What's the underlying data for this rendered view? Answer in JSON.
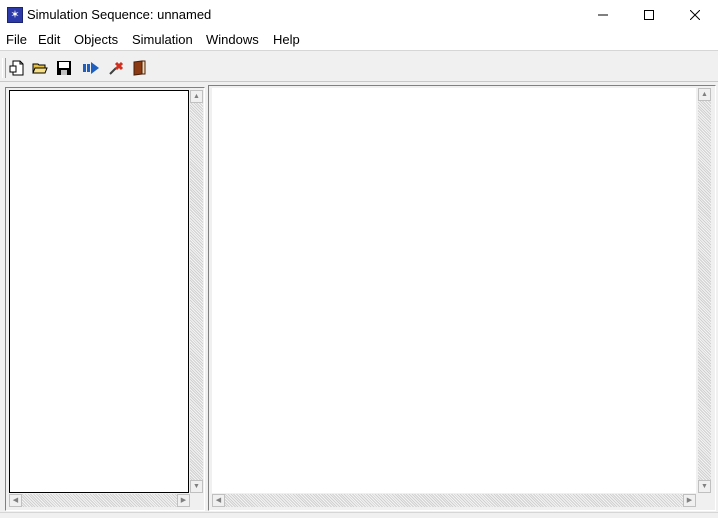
{
  "window": {
    "title": "Simulation Sequence: unnamed"
  },
  "menu": [
    "File",
    "Edit",
    "Objects",
    "Simulation",
    "Windows",
    "Help"
  ],
  "toolbar": {
    "icons": [
      "new-document-icon",
      "open-folder-icon",
      "save-disk-icon",
      "run-simulation-icon",
      "stop-simulation-icon",
      "book-icon"
    ]
  },
  "scroll_glyphs": {
    "up": "▲",
    "down": "▼",
    "left": "◀",
    "right": "▶"
  },
  "colors": {
    "app_icon": "#2b3aa8",
    "run_blue": "#1f5fbf",
    "stop_red": "#d03020",
    "book_brown": "#8b3a14"
  }
}
